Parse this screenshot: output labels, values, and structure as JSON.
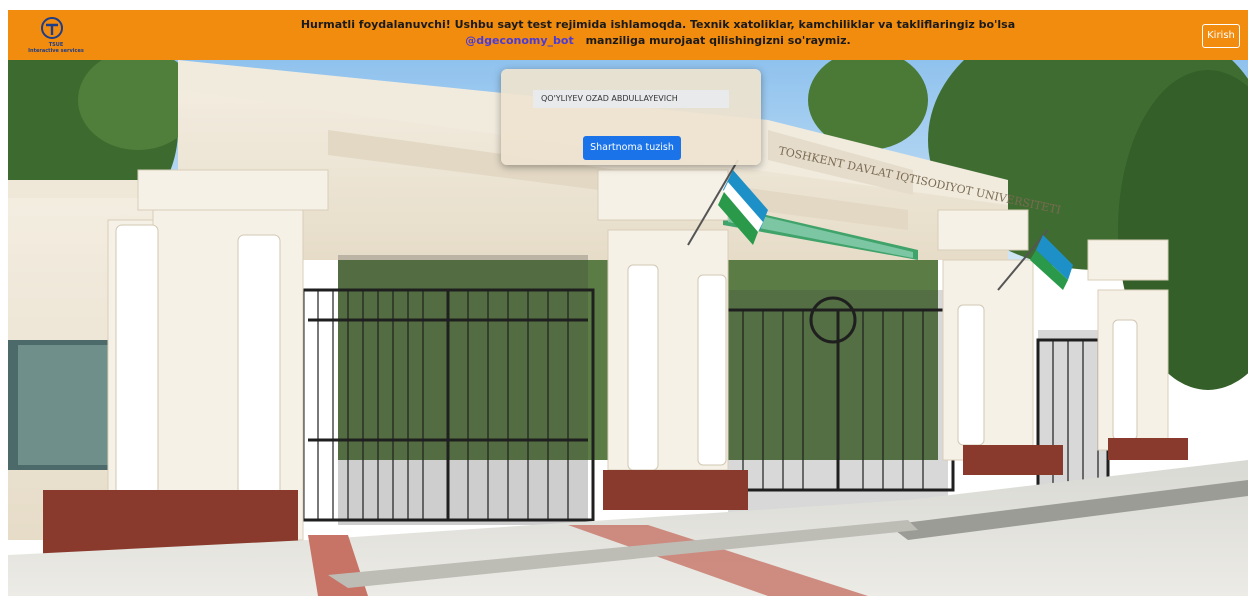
{
  "header": {
    "logo_text": "TSUE\nInteractive services",
    "notice_line1": "Hurmatli foydalanuvchi! Ushbu sayt test rejimida ishlamoqda. Texnik xatoliklar, kamchiliklar va takliflaringiz bo'lsa",
    "bot_link": "@dgeconomy_bot",
    "notice_line2_rest": "manziliga murojaat qilishingizni so'raymiz.",
    "login_label": "Kirish"
  },
  "form": {
    "name_value": "QO'YLIYEV OZAD ABDULLAYEVICH",
    "submit_label": "Shartnoma tuzish"
  },
  "hero": {
    "building_sign": "TOSHKENT DAVLAT IQTISODIYOT UNIVERSITETI"
  },
  "colors": {
    "banner": "#f28c0f",
    "button": "#1a73e8",
    "link": "#4b3bd6"
  }
}
